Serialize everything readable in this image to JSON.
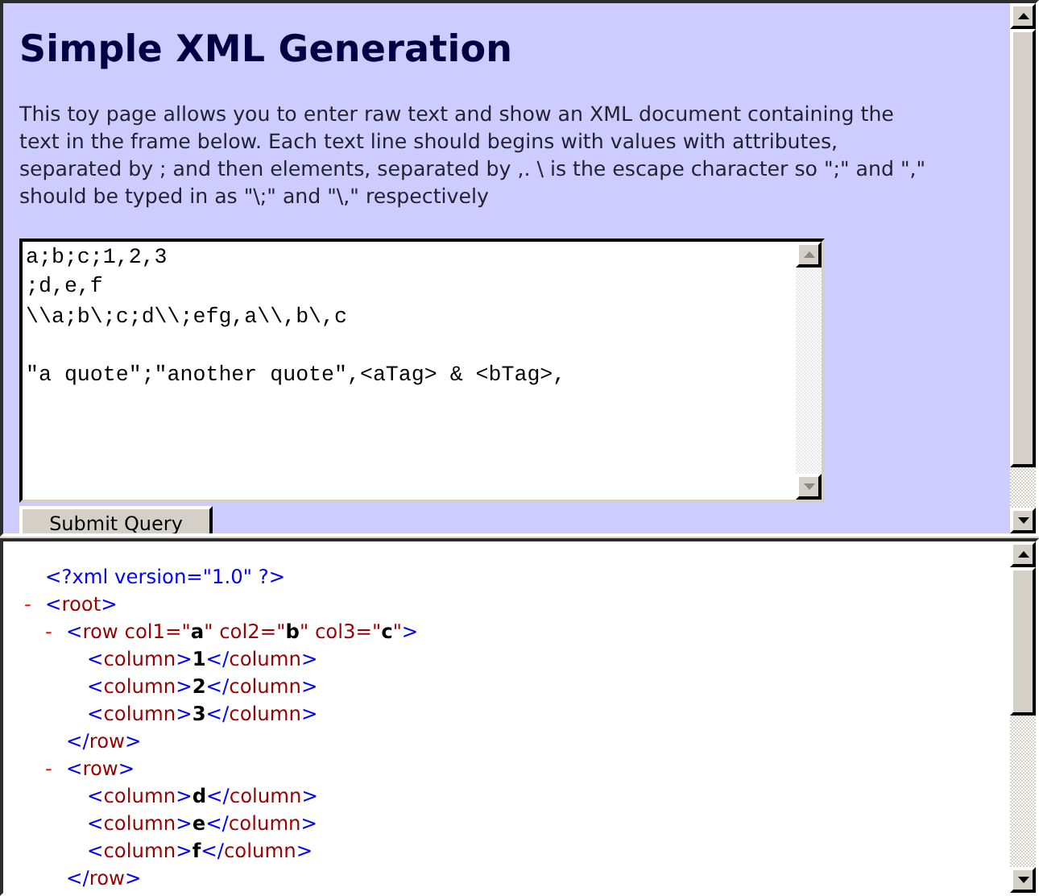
{
  "form_frame": {
    "title": "Simple XML Generation",
    "description": "This toy page allows you to enter raw text and show an XML document containing the text in the frame below. Each text line should begins with values with attributes, separated by ; and then elements, separated by ,. \\ is the escape character so \";\" and \",\" should be typed in as \"\\;\" and \"\\,\" respectively",
    "input_text": "a;b;c;1,2,3\n;d,e,f\n\\\\a;b\\;c;d\\\\;efg,a\\\\,b\\,c\n\n\"a quote\";\"another quote\",<aTag> & <bTag>,",
    "submit_button": "Submit Query"
  },
  "xml_frame": {
    "nodes": [
      {
        "parts": [
          {
            "kind": "punct",
            "text": "<?"
          },
          {
            "kind": "punct",
            "text": "xml version=\"1.0\" "
          },
          {
            "kind": "punct",
            "text": "?>"
          }
        ]
      },
      {
        "toggle": "-",
        "parts": [
          {
            "kind": "punct",
            "text": "<"
          },
          {
            "kind": "name",
            "text": "root"
          },
          {
            "kind": "punct",
            "text": ">"
          }
        ],
        "children": [
          {
            "toggle": "-",
            "parts": [
              {
                "kind": "punct",
                "text": "<"
              },
              {
                "kind": "name",
                "text": "row"
              },
              {
                "kind": "name",
                "text": " col1=\""
              },
              {
                "kind": "value",
                "text": "a"
              },
              {
                "kind": "name",
                "text": "\" col2=\""
              },
              {
                "kind": "value",
                "text": "b"
              },
              {
                "kind": "name",
                "text": "\" col3=\""
              },
              {
                "kind": "value",
                "text": "c"
              },
              {
                "kind": "name",
                "text": "\""
              },
              {
                "kind": "punct",
                "text": ">"
              }
            ],
            "children": [
              {
                "parts": [
                  {
                    "kind": "punct",
                    "text": "<"
                  },
                  {
                    "kind": "name",
                    "text": "column"
                  },
                  {
                    "kind": "punct",
                    "text": ">"
                  },
                  {
                    "kind": "value",
                    "text": "1"
                  },
                  {
                    "kind": "punct",
                    "text": "</"
                  },
                  {
                    "kind": "name",
                    "text": "column"
                  },
                  {
                    "kind": "punct",
                    "text": ">"
                  }
                ]
              },
              {
                "parts": [
                  {
                    "kind": "punct",
                    "text": "<"
                  },
                  {
                    "kind": "name",
                    "text": "column"
                  },
                  {
                    "kind": "punct",
                    "text": ">"
                  },
                  {
                    "kind": "value",
                    "text": "2"
                  },
                  {
                    "kind": "punct",
                    "text": "</"
                  },
                  {
                    "kind": "name",
                    "text": "column"
                  },
                  {
                    "kind": "punct",
                    "text": ">"
                  }
                ]
              },
              {
                "parts": [
                  {
                    "kind": "punct",
                    "text": "<"
                  },
                  {
                    "kind": "name",
                    "text": "column"
                  },
                  {
                    "kind": "punct",
                    "text": ">"
                  },
                  {
                    "kind": "value",
                    "text": "3"
                  },
                  {
                    "kind": "punct",
                    "text": "</"
                  },
                  {
                    "kind": "name",
                    "text": "column"
                  },
                  {
                    "kind": "punct",
                    "text": ">"
                  }
                ]
              }
            ],
            "closing": [
              {
                "kind": "punct",
                "text": "</"
              },
              {
                "kind": "name",
                "text": "row"
              },
              {
                "kind": "punct",
                "text": ">"
              }
            ]
          },
          {
            "toggle": "-",
            "parts": [
              {
                "kind": "punct",
                "text": "<"
              },
              {
                "kind": "name",
                "text": "row"
              },
              {
                "kind": "punct",
                "text": ">"
              }
            ],
            "children": [
              {
                "parts": [
                  {
                    "kind": "punct",
                    "text": "<"
                  },
                  {
                    "kind": "name",
                    "text": "column"
                  },
                  {
                    "kind": "punct",
                    "text": ">"
                  },
                  {
                    "kind": "value",
                    "text": "d"
                  },
                  {
                    "kind": "punct",
                    "text": "</"
                  },
                  {
                    "kind": "name",
                    "text": "column"
                  },
                  {
                    "kind": "punct",
                    "text": ">"
                  }
                ]
              },
              {
                "parts": [
                  {
                    "kind": "punct",
                    "text": "<"
                  },
                  {
                    "kind": "name",
                    "text": "column"
                  },
                  {
                    "kind": "punct",
                    "text": ">"
                  },
                  {
                    "kind": "value",
                    "text": "e"
                  },
                  {
                    "kind": "punct",
                    "text": "</"
                  },
                  {
                    "kind": "name",
                    "text": "column"
                  },
                  {
                    "kind": "punct",
                    "text": ">"
                  }
                ]
              },
              {
                "parts": [
                  {
                    "kind": "punct",
                    "text": "<"
                  },
                  {
                    "kind": "name",
                    "text": "column"
                  },
                  {
                    "kind": "punct",
                    "text": ">"
                  },
                  {
                    "kind": "value",
                    "text": "f"
                  },
                  {
                    "kind": "punct",
                    "text": "</"
                  },
                  {
                    "kind": "name",
                    "text": "column"
                  },
                  {
                    "kind": "punct",
                    "text": ">"
                  }
                ]
              }
            ],
            "closing": [
              {
                "kind": "punct",
                "text": "</"
              },
              {
                "kind": "name",
                "text": "row"
              },
              {
                "kind": "punct",
                "text": ">"
              }
            ]
          }
        ]
      }
    ]
  }
}
